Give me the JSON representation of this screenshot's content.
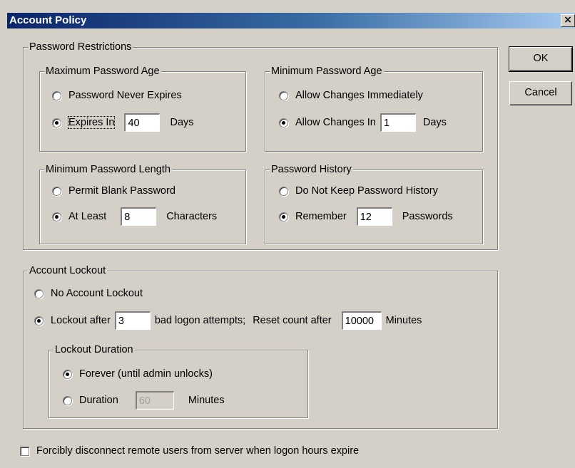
{
  "window": {
    "title": "Account Policy",
    "close_label": "×"
  },
  "buttons": {
    "ok": "OK",
    "cancel": "Cancel"
  },
  "password_restrictions": {
    "label": "Password Restrictions",
    "max_age": {
      "label": "Maximum Password Age",
      "option_never": "Password Never Expires",
      "option_expires": "Expires In",
      "expires_value": "40",
      "unit": "Days",
      "selected": "expires"
    },
    "min_age": {
      "label": "Minimum Password Age",
      "option_immediately": "Allow Changes Immediately",
      "option_in": "Allow Changes In",
      "in_value": "1",
      "unit": "Days",
      "selected": "in"
    },
    "min_length": {
      "label": "Minimum Password Length",
      "option_blank": "Permit Blank Password",
      "option_least": "At Least",
      "least_value": "8",
      "unit": "Characters",
      "selected": "least"
    },
    "history": {
      "label": "Password History",
      "option_none": "Do Not Keep Password History",
      "option_remember": "Remember",
      "remember_value": "12",
      "unit": "Passwords",
      "selected": "remember"
    }
  },
  "account_lockout": {
    "label": "Account Lockout",
    "option_none": "No Account Lockout",
    "option_after": "Lockout after",
    "after_value": "3",
    "attempts_label": "bad logon attempts;",
    "reset_label": "Reset count after",
    "reset_value": "10000",
    "reset_unit": "Minutes",
    "selected": "after",
    "duration": {
      "label": "Lockout Duration",
      "option_forever": "Forever (until admin unlocks)",
      "option_duration": "Duration",
      "duration_value": "60",
      "unit": "Minutes",
      "selected": "forever"
    }
  },
  "disconnect": {
    "label": "Forcibly disconnect remote users from server when logon hours expire",
    "checked": false
  }
}
